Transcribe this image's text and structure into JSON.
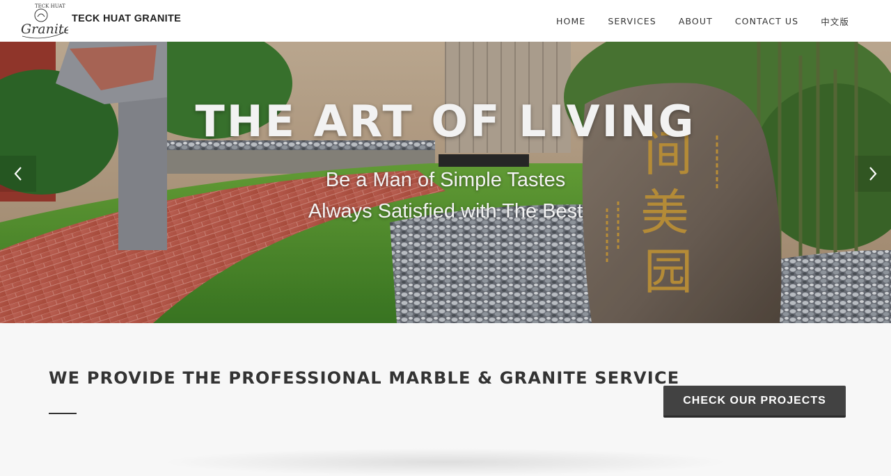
{
  "header": {
    "brand": "TECK HUAT GRANITE",
    "logo_text": "TECK HUAT",
    "logo_script": "Granite",
    "nav": [
      "HOME",
      "SERVICES",
      "ABOUT",
      "CONTACT US",
      "中文版"
    ]
  },
  "hero": {
    "title": "THE ART OF LIVING",
    "subtitle_line1": "Be a Man of Simple Tastes",
    "subtitle_line2": "Always Satisfied with The Best",
    "prev_icon": "chevron-left-icon",
    "next_icon": "chevron-right-icon"
  },
  "service": {
    "heading": "WE PROVIDE THE PROFESSIONAL MARBLE & GRANITE SERVICE",
    "cta_label": "CHECK OUR PROJECTS"
  },
  "colors": {
    "header_bg": "#ffffff",
    "section_bg": "#f7f7f7",
    "cta_bg": "#424242",
    "text_dark": "#333333"
  }
}
